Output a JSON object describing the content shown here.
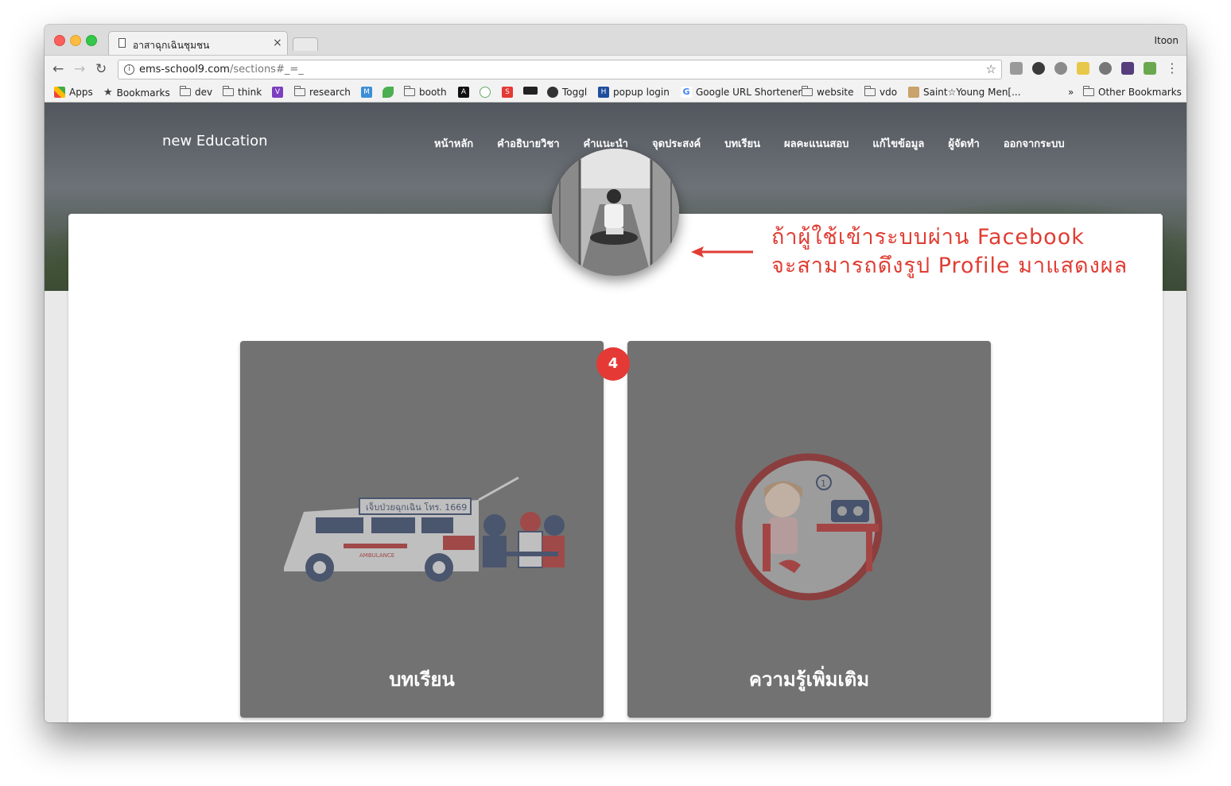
{
  "browser": {
    "tab_title": "อาสาฉุกเฉินชุมชน",
    "tab_close": "×",
    "profile_name": "Itoon",
    "url_host": "ems-school9.com",
    "url_path": "/sections#_=_",
    "back": "←",
    "forward": "→",
    "reload": "↻",
    "star": "☆",
    "info": "i",
    "menu": "⋮"
  },
  "bookmarks": {
    "apps": "Apps",
    "items": [
      "Bookmarks",
      "dev",
      "think",
      "research",
      "booth",
      "Toggl",
      "popup login",
      "Google URL Shortener",
      "website",
      "vdo",
      "Saint☆Young Men[...",
      "Other Bookmarks"
    ],
    "overflow": "»"
  },
  "site": {
    "brand": "new Education",
    "nav": [
      "หน้าหลัก",
      "คำอธิบายวิชา",
      "คำแนะนำ",
      "จุดประสงค์",
      "บทเรียน",
      "ผลคะแนนสอบ",
      "แก้ไขข้อมูล",
      "ผู้จัดทำ",
      "ออกจากระบบ"
    ],
    "tiles": [
      {
        "label": "บทเรียน",
        "sign_text": "เจ็บป่วยฉุกเฉิน โทร. 1669",
        "van_text": "AMBULANCE"
      },
      {
        "label": "ความรู้เพิ่มเติม",
        "step_number": "1"
      }
    ],
    "badge": "4"
  },
  "annotation": {
    "line1": "ถ้าผู้ใช้เข้าระบบผ่าน Facebook",
    "line2": "จะสามารถดึงรูป Profile มาแสดงผล",
    "color": "#e03d33"
  }
}
